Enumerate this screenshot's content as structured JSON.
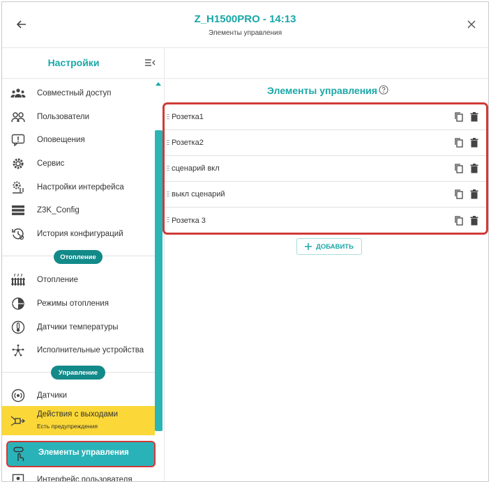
{
  "header": {
    "title": "Z_H1500PRO  - 14:13",
    "subtitle": "Элементы управления"
  },
  "sidebar": {
    "title": "Настройки",
    "items_top": [
      {
        "label": "Совместный доступ",
        "icon": "shared-access-icon"
      },
      {
        "label": "Пользователи",
        "icon": "users-icon"
      },
      {
        "label": "Оповещения",
        "icon": "notifications-icon"
      },
      {
        "label": "Сервис",
        "icon": "service-icon"
      },
      {
        "label": "Настройки интерфейса",
        "icon": "interface-settings-icon"
      },
      {
        "label": "Z3K_Config",
        "icon": "config-icon"
      },
      {
        "label": "История конфигураций",
        "icon": "history-icon"
      }
    ],
    "section_heating": "Отопление",
    "items_heating": [
      {
        "label": "Отопление",
        "icon": "radiator-icon"
      },
      {
        "label": "Режимы отопления",
        "icon": "heating-modes-icon"
      },
      {
        "label": "Датчики температуры",
        "icon": "thermometer-icon"
      },
      {
        "label": "Исполнительные устройства",
        "icon": "actuators-icon"
      }
    ],
    "section_control": "Управление",
    "items_control": [
      {
        "label": "Датчики",
        "icon": "sensors-icon"
      }
    ],
    "warn_item": {
      "label": "Действия с выходами",
      "sublabel": "Есть предупреждения"
    },
    "active_item": {
      "label": "Элементы управления"
    },
    "last_item": {
      "label": "Интерфейс пользователя"
    }
  },
  "main": {
    "title": "Элементы управления",
    "rows": [
      {
        "label": "Розетка1"
      },
      {
        "label": "Розетка2"
      },
      {
        "label": "сценарий вкл"
      },
      {
        "label": "выкл сценарий"
      },
      {
        "label": "Розетка 3"
      }
    ],
    "add_label": "ДОБАВИТЬ"
  },
  "colors": {
    "accent": "#1aa7a7",
    "active_bg": "#29b3b8",
    "warn_bg": "#fbd838",
    "highlight": "#d03a37",
    "badge_bg": "#138a8a"
  }
}
